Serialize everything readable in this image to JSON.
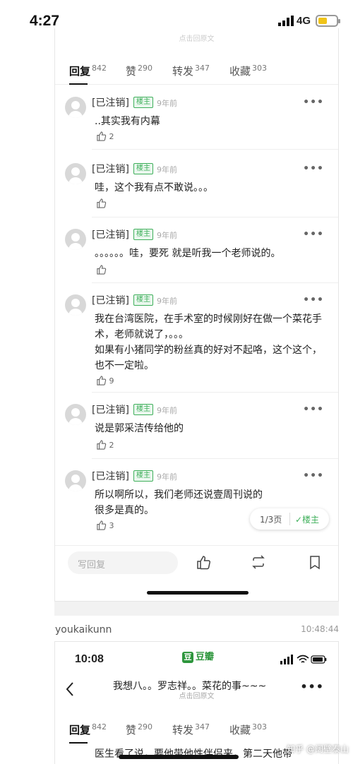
{
  "status": {
    "time": "4:27",
    "network": "4G"
  },
  "post": {
    "faded_top_text": "点击回原文",
    "tabs": [
      {
        "label": "回复",
        "count": "842"
      },
      {
        "label": "赞",
        "count": "290"
      },
      {
        "label": "转发",
        "count": "347"
      },
      {
        "label": "收藏",
        "count": "303"
      }
    ]
  },
  "comments": [
    {
      "name": "[已注销]",
      "badge": "楼主",
      "time": "9年前",
      "text": "..其实我有内幕",
      "likes": "2"
    },
    {
      "name": "[已注销]",
      "badge": "楼主",
      "time": "9年前",
      "text": "哇，这个我有点不敢说。。。",
      "likes": ""
    },
    {
      "name": "[已注销]",
      "badge": "楼主",
      "time": "9年前",
      "text": "。。。。。。哇，要死 就是听我一个老师说的。",
      "likes": ""
    },
    {
      "name": "[已注销]",
      "badge": "楼主",
      "time": "9年前",
      "text": "我在台湾医院，在手术室的时候刚好在做一个菜花手术，老师就说了，。。。\n如果有小猪同学的粉丝真的好对不起咯，这个这个，也不一定啦。",
      "likes": "9"
    },
    {
      "name": "[已注销]",
      "badge": "楼主",
      "time": "9年前",
      "text": "说是郭采洁传给他的",
      "likes": "2"
    },
    {
      "name": "[已注销]",
      "badge": "楼主",
      "time": "9年前",
      "text": "所以啊所以，我们老师还说壹周刊说的很多是真的。",
      "likes": "3"
    }
  ],
  "pager": {
    "page": "1/3页",
    "op_filter": "✓楼主"
  },
  "bottom_bar": {
    "reply_placeholder": "写回复"
  },
  "second_post": {
    "username": "youkaikunn",
    "timestamp": "10:48:44",
    "status_time": "10:08",
    "app_name": "豆瓣",
    "app_glyph": "豆",
    "title": "我想八。。罗志祥。。菜花的事~~~",
    "subtitle": "点击回原文",
    "tabs": [
      {
        "label": "回复",
        "count": "842"
      },
      {
        "label": "赞",
        "count": "290"
      },
      {
        "label": "转发",
        "count": "347"
      },
      {
        "label": "收藏",
        "count": "303"
      }
    ],
    "clipped_text": "医生看了说，要他带他性伴侣来，第二天他带"
  },
  "watermark": "知乎 @阔壁泰山"
}
